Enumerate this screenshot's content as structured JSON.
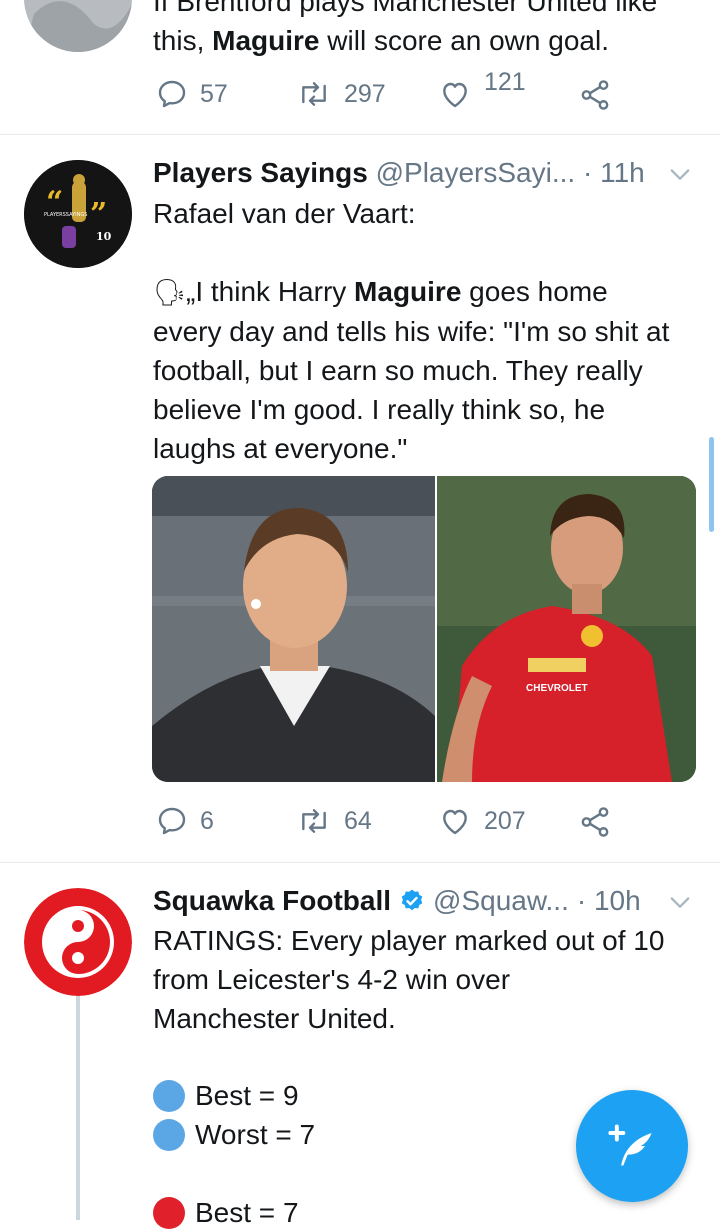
{
  "tweet1": {
    "text_line1": "If Brentford plays Manchester United like",
    "text_line2_pre": "this, ",
    "text_line2_bold": "Maguire",
    "text_line2_post": " will score an own goal.",
    "replies": "57",
    "retweets": "297",
    "likes": "121"
  },
  "tweet2": {
    "name": "Players Sayings",
    "handle": "@PlayersSayi...",
    "time": "· 11h",
    "line1": "Rafael van der Vaart:",
    "quote_emoji": "🗣",
    "quote_l1_pre": "„I think Harry ",
    "quote_l1_bold": "Maguire",
    "quote_l1_post": " goes home",
    "quote_l2": "every day and tells his wife: \"I'm so shit at",
    "quote_l3": "football, but I earn so much. They really",
    "quote_l4": "believe I'm good. I really think so, he",
    "quote_l5": "laughs at everyone.\"",
    "avatar_number": "10",
    "image_sponsor": "CHEVROLET",
    "replies": "6",
    "retweets": "64",
    "likes": "207"
  },
  "tweet3": {
    "name": "Squawka Football",
    "handle": "@Squaw...",
    "time": "· 10h",
    "line1": "RATINGS: Every player marked out of 10",
    "line2": "from Leicester's 4-2 win over",
    "line3": "Manchester United.",
    "item1": "Best = 9",
    "item2": "Worst = 7",
    "item3": "Best = 7"
  },
  "colors": {
    "accent": "#1da1f2",
    "text": "#14171a",
    "muted": "#657786",
    "blue_dot": "#5ba7e6",
    "red_dot": "#e0202a"
  },
  "icons": [
    "reply-icon",
    "retweet-icon",
    "like-icon",
    "share-icon",
    "chevron-down-icon",
    "verified-icon",
    "compose-icon",
    "speaking-head-icon"
  ]
}
